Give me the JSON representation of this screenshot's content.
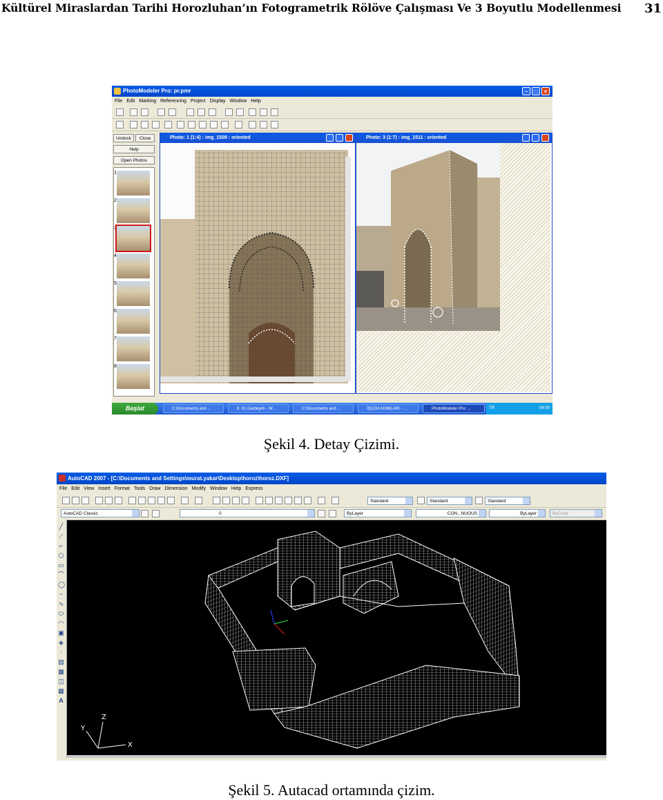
{
  "page": {
    "running_title": "Kültürel Miraslardan Tarihi Horozluhan’ın Fotogrametrik Rölöve Çalışması Ve 3 Boyutlu Modellenmesi",
    "page_number": "31"
  },
  "figure4": {
    "caption": "Şekil 4. Detay Çizimi.",
    "window_title": "PhotoModeler Pro: pr.pmr",
    "menu": [
      "File",
      "Edit",
      "Marking",
      "Referencing",
      "Project",
      "Display",
      "Window",
      "Help"
    ],
    "side_buttons": {
      "undock": "Undock",
      "close": "Close",
      "help": "Help",
      "open_photos": "Open Photos"
    },
    "thumb_numbers": [
      "1",
      "2",
      "3",
      "4",
      "5",
      "6",
      "7",
      "8"
    ],
    "photo1_title": "Photo: 1 (1:4) : img_1509 : oriented",
    "photo2_title": "Photo: 3 (1:7) : img_1511 : oriented",
    "taskbar": {
      "start": "Başlat",
      "tasks": [
        "C:\\Documents and ...",
        "8. 01 Dardeyim - W...",
        "C:\\Documents and ...",
        "İŞLEM ADIMLARI - ...",
        "PhotoModeler Pro: ..."
      ],
      "lang": "TR",
      "clock": "04:00"
    },
    "colors": {
      "titlebar": "#0a5ce6",
      "start_button": "#3ea83e",
      "selected_thumb_outline": "#d01818"
    }
  },
  "figure5": {
    "caption": "Şekil 5. Autacad ortamında çizim.",
    "window_title": "AutoCAD 2007 - [C:\\Documents and Settings\\murat.yakar\\Desktop\\horoz\\horoz.DXF]",
    "menu": [
      "File",
      "Edit",
      "View",
      "Insert",
      "Format",
      "Tools",
      "Draw",
      "Dimension",
      "Modify",
      "Window",
      "Help",
      "Express"
    ],
    "text_style": "Standard",
    "dim_style": "Standard",
    "table_style": "Standard",
    "workspace": "AutoCAD Classic",
    "layer": "0",
    "color": "ByLayer",
    "linetype": "CON...NUOUS",
    "lineweight": "ByLayer",
    "plotstyle": "ByColor",
    "ucs_labels": {
      "x": "X",
      "y": "Y",
      "z": "Z"
    },
    "colors": {
      "canvas": "#000000",
      "wireframe": "#ffffff"
    }
  }
}
